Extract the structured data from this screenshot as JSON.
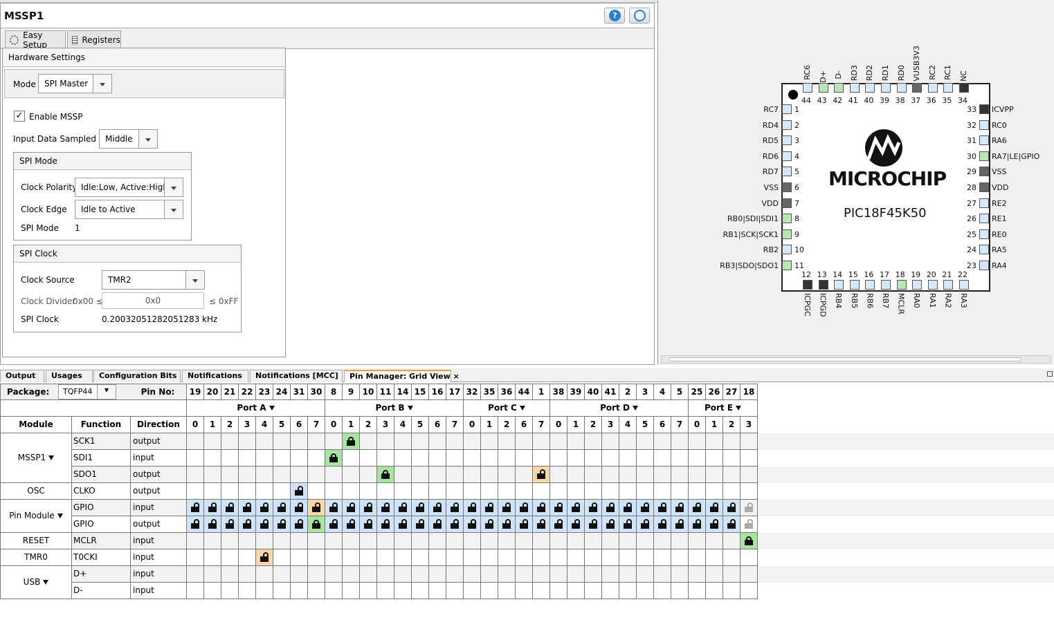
{
  "window": {
    "title": "MSSP1",
    "help_icon": "help-icon",
    "web_icon": "globe-icon"
  },
  "tabs": [
    {
      "label": "Easy Setup",
      "icon": "gear-icon"
    },
    {
      "label": "Registers",
      "icon": "registers-icon"
    }
  ],
  "hardware": {
    "title": "Hardware Settings",
    "mode_label": "Mode",
    "mode_value": "SPI Master",
    "enable_label": "Enable MSSP",
    "enable_checked": true,
    "sampled_label": "Input Data Sampled at",
    "sampled_value": "Middle",
    "spi_mode": {
      "title": "SPI Mode",
      "polarity_label": "Clock Polarity",
      "polarity_value": "Idle:Low, Active:High",
      "edge_label": "Clock Edge",
      "edge_value": "Idle to Active",
      "mode_label": "SPI Mode",
      "mode_value": "1"
    },
    "spi_clock": {
      "title": "SPI Clock",
      "source_label": "Clock Source",
      "source_value": "TMR2",
      "divider_label": "Clock Divider",
      "divider_min": "0x00 ≤",
      "divider_value": "0x0",
      "divider_max": "≤ 0xFF",
      "clock_label": "SPI Clock",
      "clock_value": "0.20032051282051283 kHz"
    }
  },
  "chip": {
    "brand": "MICROCHIP",
    "part": "PIC18F45K50",
    "top_pins": [
      {
        "num": "44",
        "name": "RC6",
        "color": "b"
      },
      {
        "num": "43",
        "name": "D+",
        "color": "g"
      },
      {
        "num": "42",
        "name": "D-",
        "color": "g"
      },
      {
        "num": "41",
        "name": "RD3",
        "color": "b"
      },
      {
        "num": "40",
        "name": "RD2",
        "color": "b"
      },
      {
        "num": "39",
        "name": "RD1",
        "color": "b"
      },
      {
        "num": "38",
        "name": "RD0",
        "color": "b"
      },
      {
        "num": "37",
        "name": "VUSB3V3",
        "color": "d"
      },
      {
        "num": "36",
        "name": "RC2",
        "color": "b"
      },
      {
        "num": "35",
        "name": "RC1",
        "color": "b"
      },
      {
        "num": "34",
        "name": "NC",
        "color": "k"
      }
    ],
    "left_pins": [
      {
        "num": "1",
        "name": "RC7",
        "color": "b"
      },
      {
        "num": "2",
        "name": "RD4",
        "color": "b"
      },
      {
        "num": "3",
        "name": "RD5",
        "color": "b"
      },
      {
        "num": "4",
        "name": "RD6",
        "color": "b"
      },
      {
        "num": "5",
        "name": "RD7",
        "color": "b"
      },
      {
        "num": "6",
        "name": "VSS",
        "color": "d"
      },
      {
        "num": "7",
        "name": "VDD",
        "color": "d"
      },
      {
        "num": "8",
        "name": "RB0|SDI|SDI1",
        "color": "g"
      },
      {
        "num": "9",
        "name": "RB1|SCK|SCK1",
        "color": "g"
      },
      {
        "num": "10",
        "name": "RB2",
        "color": "b"
      },
      {
        "num": "11",
        "name": "RB3|SDO|SDO1",
        "color": "g"
      }
    ],
    "right_pins": [
      {
        "num": "33",
        "name": "ICVPP",
        "color": "k"
      },
      {
        "num": "32",
        "name": "RC0",
        "color": "b"
      },
      {
        "num": "31",
        "name": "RA6",
        "color": "b"
      },
      {
        "num": "30",
        "name": "RA7|LE|GPIO",
        "color": "g"
      },
      {
        "num": "29",
        "name": "VSS",
        "color": "d"
      },
      {
        "num": "28",
        "name": "VDD",
        "color": "d"
      },
      {
        "num": "27",
        "name": "RE2",
        "color": "b"
      },
      {
        "num": "26",
        "name": "RE1",
        "color": "b"
      },
      {
        "num": "25",
        "name": "RE0",
        "color": "b"
      },
      {
        "num": "24",
        "name": "RA5",
        "color": "b"
      },
      {
        "num": "23",
        "name": "RA4",
        "color": "b"
      }
    ],
    "bottom_pins": [
      {
        "num": "12",
        "name": "ICPGC",
        "color": "k"
      },
      {
        "num": "13",
        "name": "ICPGD",
        "color": "k"
      },
      {
        "num": "14",
        "name": "RB4",
        "color": "b"
      },
      {
        "num": "15",
        "name": "RB5",
        "color": "b"
      },
      {
        "num": "16",
        "name": "RB6",
        "color": "b"
      },
      {
        "num": "17",
        "name": "RB7",
        "color": "b"
      },
      {
        "num": "18",
        "name": "MCLR",
        "color": "g"
      },
      {
        "num": "19",
        "name": "RA0",
        "color": "b"
      },
      {
        "num": "20",
        "name": "RA1",
        "color": "b"
      },
      {
        "num": "21",
        "name": "RA2",
        "color": "b"
      },
      {
        "num": "22",
        "name": "RA3",
        "color": "b"
      }
    ]
  },
  "bottom_tabs": [
    {
      "label": "Output"
    },
    {
      "label": "Usages"
    },
    {
      "label": "Configuration Bits"
    },
    {
      "label": "Notifications"
    },
    {
      "label": "Notifications [MCC]"
    },
    {
      "label": "Pin Manager: Grid View",
      "active": true
    }
  ],
  "grid": {
    "package_label": "Package:",
    "package_value": "TQFP44",
    "pinno_label": "Pin No:",
    "pin_numbers": [
      "19",
      "20",
      "21",
      "22",
      "23",
      "24",
      "31",
      "30",
      "8",
      "9",
      "10",
      "11",
      "14",
      "15",
      "16",
      "17",
      "32",
      "35",
      "36",
      "44",
      "1",
      "38",
      "39",
      "40",
      "41",
      "2",
      "3",
      "4",
      "5",
      "25",
      "26",
      "27",
      "18"
    ],
    "ports": [
      {
        "label": "Port A",
        "bits": [
          "0",
          "1",
          "2",
          "3",
          "4",
          "5",
          "6",
          "7"
        ]
      },
      {
        "label": "Port B",
        "bits": [
          "0",
          "1",
          "2",
          "3",
          "4",
          "5",
          "6",
          "7"
        ]
      },
      {
        "label": "Port C",
        "bits": [
          "0",
          "1",
          "2",
          "6",
          "7"
        ]
      },
      {
        "label": "Port D",
        "bits": [
          "0",
          "1",
          "2",
          "3",
          "4",
          "5",
          "6",
          "7"
        ]
      },
      {
        "label": "Port E",
        "bits": [
          "0",
          "1",
          "2",
          "3"
        ]
      }
    ],
    "col_headers": {
      "module": "Module",
      "function": "Function",
      "direction": "Direction"
    },
    "modules": [
      {
        "name": "MSSP1",
        "expand": true,
        "rows": 3
      },
      {
        "name": "OSC",
        "expand": false,
        "rows": 1
      },
      {
        "name": "Pin Module",
        "expand": true,
        "rows": 2
      },
      {
        "name": "RESET",
        "expand": false,
        "rows": 1
      },
      {
        "name": "TMR0",
        "expand": false,
        "rows": 1
      },
      {
        "name": "USB",
        "expand": true,
        "rows": 2
      }
    ],
    "rows": [
      {
        "function": "SCK1",
        "direction": "output",
        "locks": [
          {
            "col": 9,
            "type": "locked",
            "bg": "green"
          }
        ]
      },
      {
        "function": "SDI1",
        "direction": "input",
        "locks": [
          {
            "col": 8,
            "type": "locked",
            "bg": "green"
          }
        ]
      },
      {
        "function": "SDO1",
        "direction": "output",
        "locks": [
          {
            "col": 11,
            "type": "locked",
            "bg": "green"
          },
          {
            "col": 20,
            "type": "open",
            "bg": "orange"
          }
        ]
      },
      {
        "function": "CLKO",
        "direction": "output",
        "locks": [
          {
            "col": 6,
            "type": "open",
            "bg": "blue"
          }
        ]
      },
      {
        "function": "GPIO",
        "direction": "input",
        "fill": "blue-all",
        "special": [
          {
            "col": 7,
            "type": "open",
            "bg": "orange"
          },
          {
            "col": 32,
            "type": "faint",
            "bg": "none"
          }
        ]
      },
      {
        "function": "GPIO",
        "direction": "output",
        "fill": "blue-all",
        "special": [
          {
            "col": 7,
            "type": "locked",
            "bg": "green"
          },
          {
            "col": 32,
            "type": "faint",
            "bg": "none"
          }
        ]
      },
      {
        "function": "MCLR",
        "direction": "input",
        "locks": [
          {
            "col": 32,
            "type": "locked",
            "bg": "green"
          }
        ]
      },
      {
        "function": "T0CKI",
        "direction": "input",
        "locks": [
          {
            "col": 4,
            "type": "open",
            "bg": "orange"
          }
        ]
      },
      {
        "function": "D+",
        "direction": "input",
        "locks": []
      },
      {
        "function": "D-",
        "direction": "input",
        "locks": []
      }
    ],
    "colors": {
      "blue": "#cfe4f8",
      "green": "#a9e3a1",
      "orange": "#f8d8a8",
      "band": "#f2f2f2"
    }
  }
}
